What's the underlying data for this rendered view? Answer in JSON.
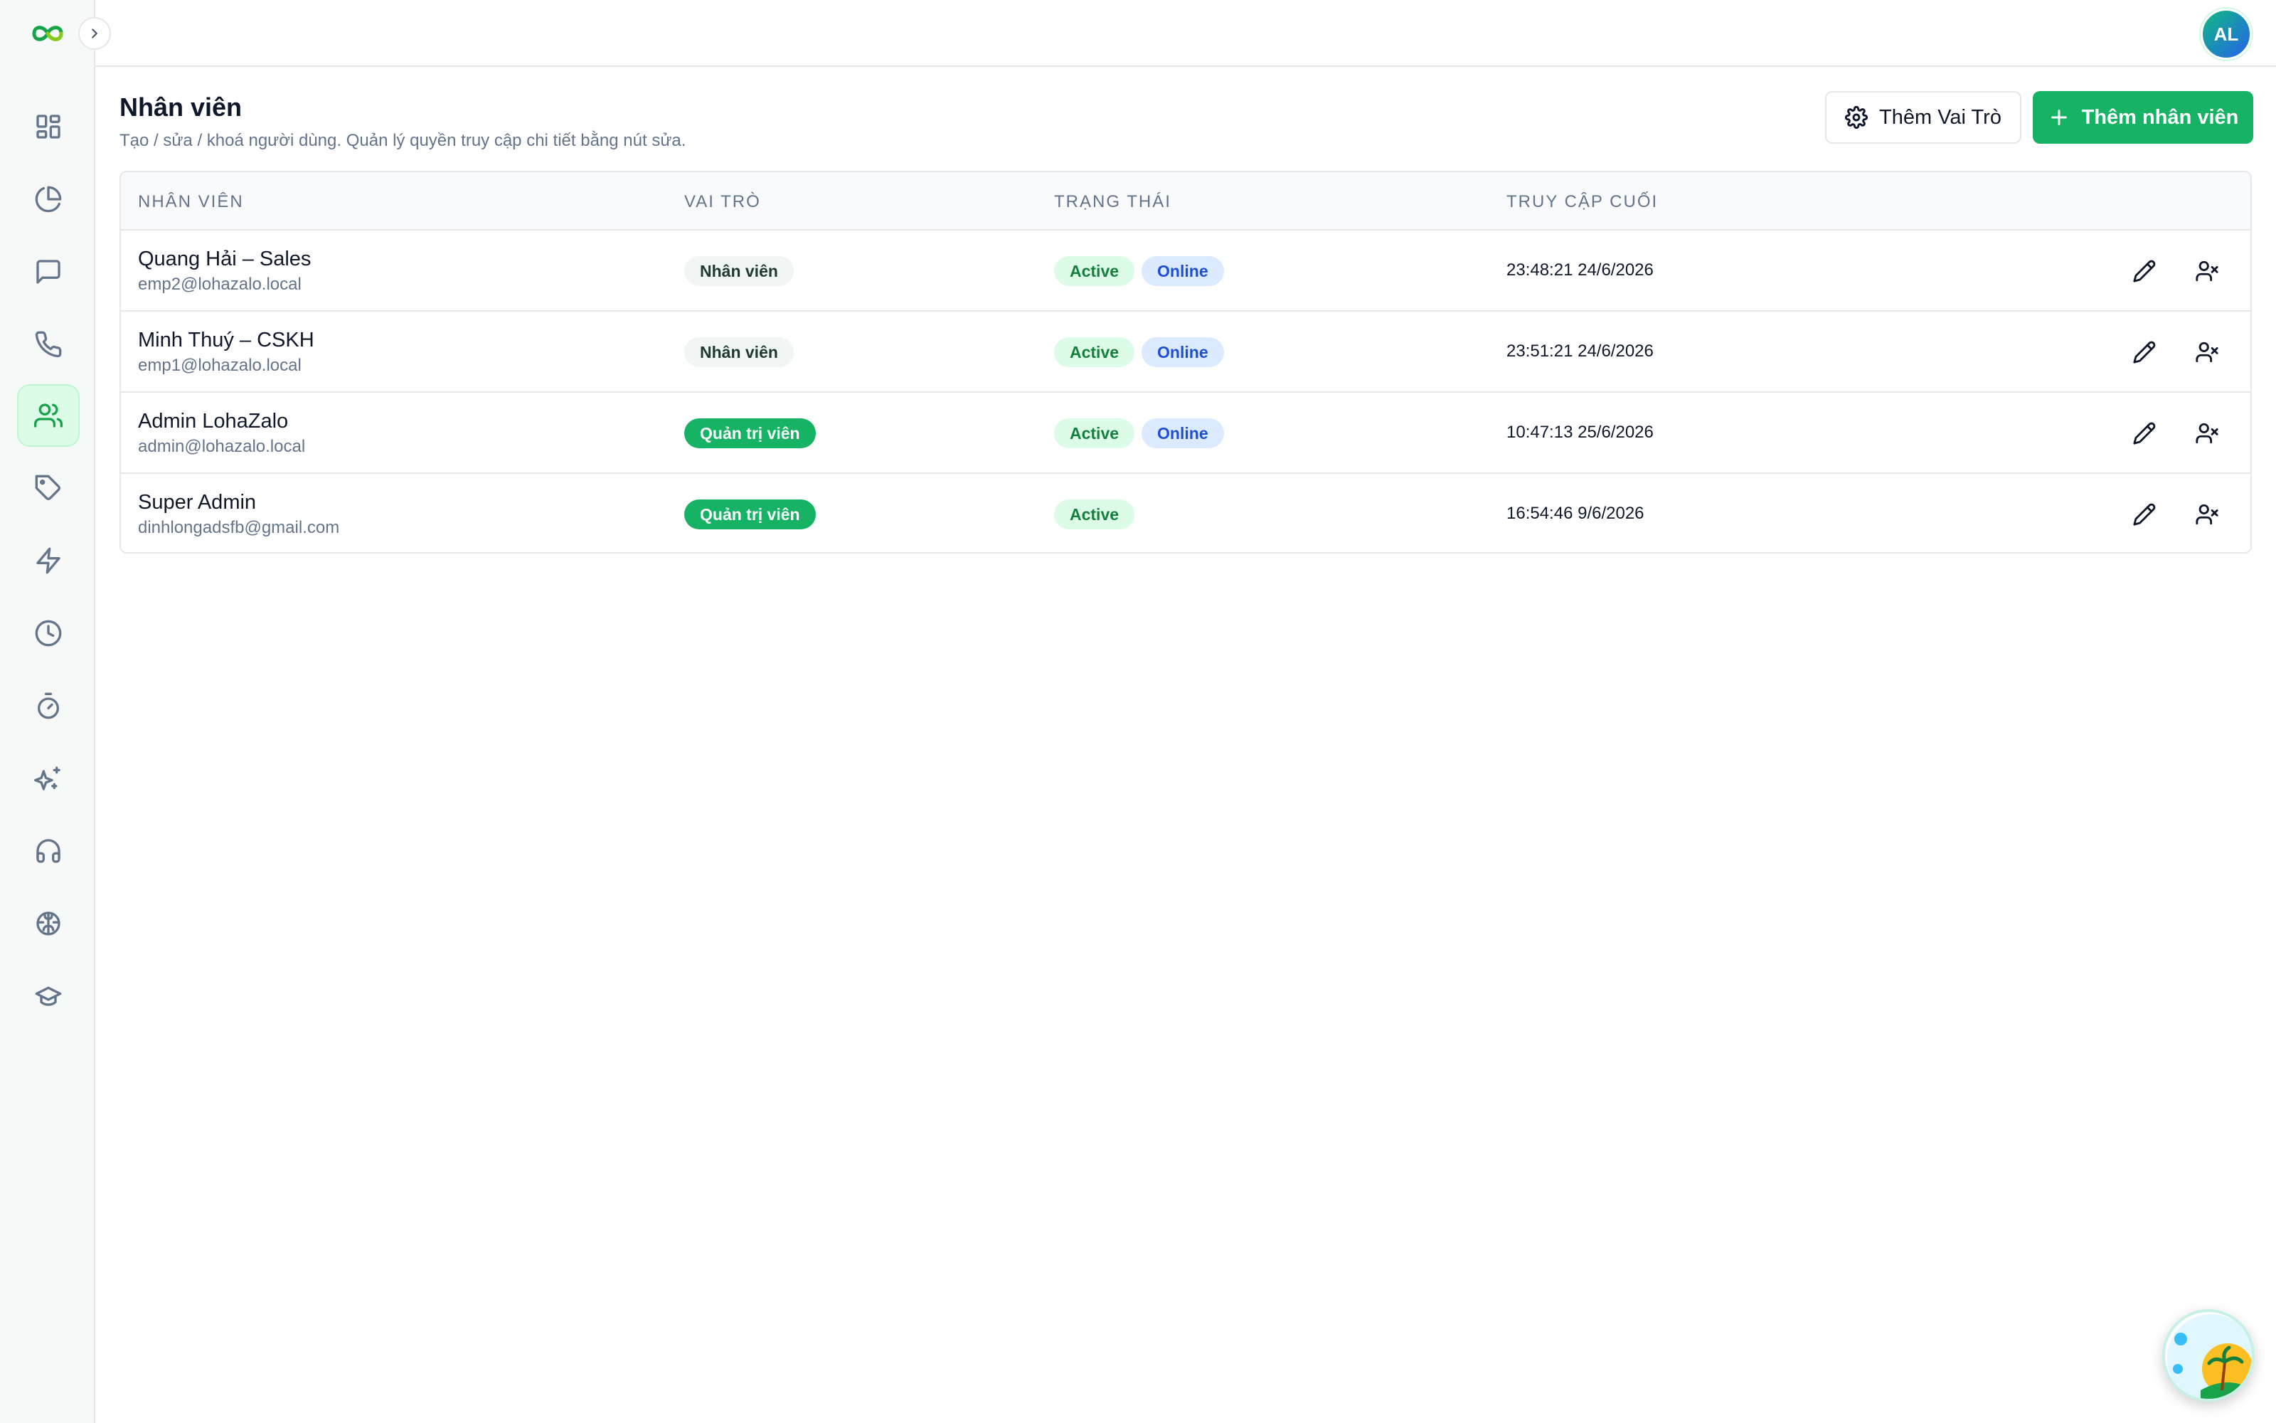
{
  "app": {
    "avatar_initials": "AL",
    "accent_color": "#16b364"
  },
  "sidebar": {
    "items": [
      {
        "icon": "dashboard-icon"
      },
      {
        "icon": "pie-chart-icon"
      },
      {
        "icon": "chat-icon"
      },
      {
        "icon": "phone-icon"
      },
      {
        "icon": "users-icon",
        "active": true
      },
      {
        "icon": "tag-icon"
      },
      {
        "icon": "zap-icon"
      },
      {
        "icon": "clock-icon"
      },
      {
        "icon": "timer-icon"
      },
      {
        "icon": "sparkles-icon"
      },
      {
        "icon": "headphones-icon"
      },
      {
        "icon": "brain-icon"
      },
      {
        "icon": "graduation-cap-icon"
      }
    ]
  },
  "header": {
    "title": "Nhân viên",
    "subtitle": "Tạo / sửa / khoá người dùng. Quản lý quyền truy cập chi tiết bằng nút sửa.",
    "add_role_label": "Thêm Vai Trò",
    "add_employee_label": "Thêm nhân viên"
  },
  "table": {
    "columns": [
      "NHÂN VIÊN",
      "VAI TRÒ",
      "TRẠNG THÁI",
      "TRUY CẬP CUỐI"
    ],
    "rows": [
      {
        "name": "Quang Hải – Sales",
        "email": "emp2@lohazalo.local",
        "role": "Nhân viên",
        "role_type": "staff",
        "status": "Active",
        "presence": "Online",
        "last_access": "23:48:21 24/6/2026"
      },
      {
        "name": "Minh Thuý – CSKH",
        "email": "emp1@lohazalo.local",
        "role": "Nhân viên",
        "role_type": "staff",
        "status": "Active",
        "presence": "Online",
        "last_access": "23:51:21 24/6/2026"
      },
      {
        "name": "Admin LohaZalo",
        "email": "admin@lohazalo.local",
        "role": "Quản trị viên",
        "role_type": "admin",
        "status": "Active",
        "presence": "Online",
        "last_access": "10:47:13 25/6/2026"
      },
      {
        "name": "Super Admin",
        "email": "dinhlongadsfb@gmail.com",
        "role": "Quản trị viên",
        "role_type": "admin",
        "status": "Active",
        "presence": null,
        "last_access": "16:54:46 9/6/2026"
      }
    ]
  }
}
